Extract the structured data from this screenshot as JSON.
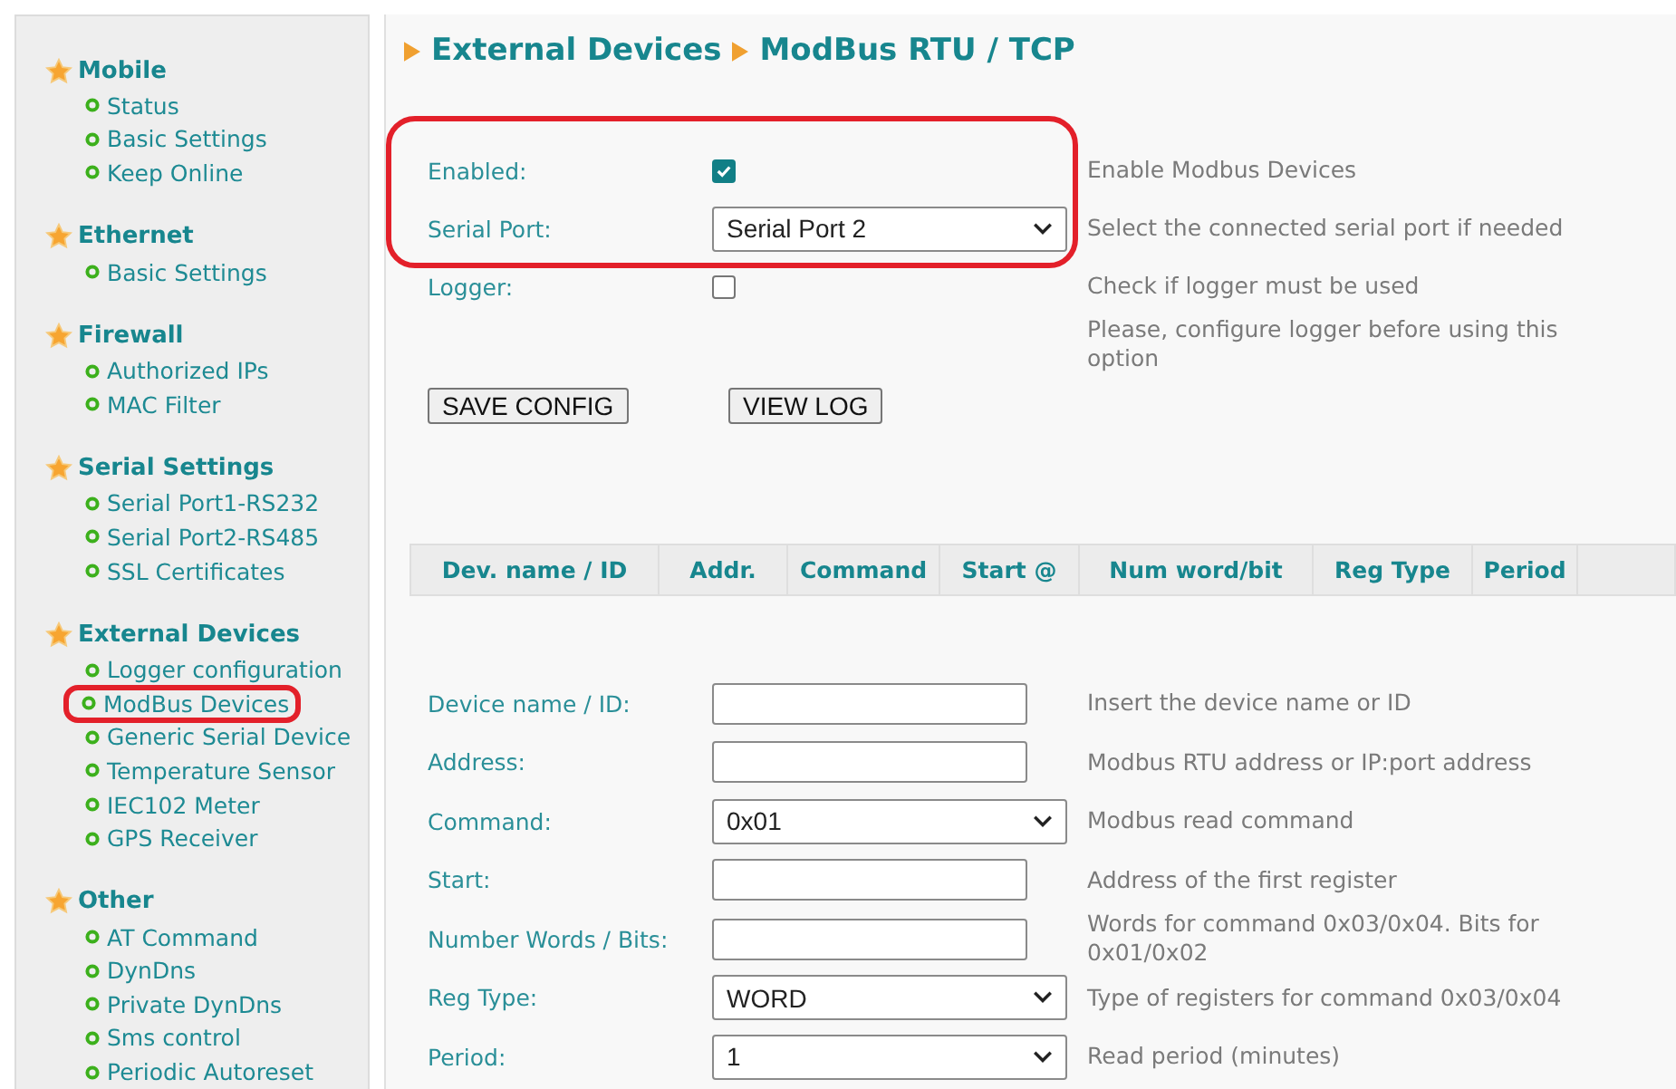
{
  "sidebar": {
    "sections": [
      {
        "title": "Mobile",
        "items": [
          {
            "label": "Status",
            "highlighted": false
          },
          {
            "label": "Basic Settings",
            "highlighted": false
          },
          {
            "label": "Keep Online",
            "highlighted": false
          }
        ]
      },
      {
        "title": "Ethernet",
        "items": [
          {
            "label": "Basic Settings",
            "highlighted": false
          }
        ]
      },
      {
        "title": "Firewall",
        "items": [
          {
            "label": "Authorized IPs",
            "highlighted": false
          },
          {
            "label": "MAC Filter",
            "highlighted": false
          }
        ]
      },
      {
        "title": "Serial Settings",
        "items": [
          {
            "label": "Serial Port1-RS232",
            "highlighted": false
          },
          {
            "label": "Serial Port2-RS485",
            "highlighted": false
          },
          {
            "label": "SSL Certificates",
            "highlighted": false
          }
        ]
      },
      {
        "title": "External Devices",
        "items": [
          {
            "label": "Logger configuration",
            "highlighted": false
          },
          {
            "label": "ModBus Devices",
            "highlighted": true
          },
          {
            "label": "Generic Serial Device",
            "highlighted": false
          },
          {
            "label": "Temperature Sensor",
            "highlighted": false
          },
          {
            "label": "IEC102 Meter",
            "highlighted": false
          },
          {
            "label": "GPS Receiver",
            "highlighted": false
          }
        ]
      },
      {
        "title": "Other",
        "items": [
          {
            "label": "AT Command",
            "highlighted": false
          },
          {
            "label": "DynDns",
            "highlighted": false
          },
          {
            "label": "Private DynDns",
            "highlighted": false
          },
          {
            "label": "Sms control",
            "highlighted": false
          },
          {
            "label": "Periodic Autoreset",
            "highlighted": false
          }
        ]
      }
    ]
  },
  "breadcrumb": [
    "External Devices",
    "ModBus RTU / TCP"
  ],
  "settings": [
    {
      "kind": "checkbox",
      "label": "Enabled:",
      "checked": true,
      "description": "Enable Modbus Devices",
      "highlighted": true
    },
    {
      "kind": "select",
      "label": "Serial Port:",
      "value": "Serial Port 2",
      "description": "Select the connected serial port if needed",
      "highlighted": true
    },
    {
      "kind": "checkbox",
      "label": "Logger:",
      "checked": false,
      "description": "Check if logger must be used",
      "highlighted": false
    },
    {
      "kind": "note",
      "description": "Please, configure logger before using this option",
      "highlighted": false
    }
  ],
  "buttons": [
    "SAVE CONFIG",
    "VIEW LOG"
  ],
  "table": {
    "columns": [
      "Dev. name / ID",
      "Addr.",
      "Command",
      "Start @",
      "Num word/bit",
      "Reg Type",
      "Period"
    ]
  },
  "device_form": [
    {
      "kind": "text",
      "label": "Device name / ID:",
      "description": "Insert the device name or ID"
    },
    {
      "kind": "text",
      "label": "Address:",
      "description": "Modbus RTU address or IP:port address"
    },
    {
      "kind": "select",
      "label": "Command:",
      "value": "0x01",
      "description": "Modbus read command"
    },
    {
      "kind": "text",
      "label": "Start:",
      "description": "Address of the first register"
    },
    {
      "kind": "text",
      "label": "Number Words / Bits:",
      "description": "Words for command 0x03/0x04. Bits for 0x01/0x02"
    },
    {
      "kind": "select",
      "label": "Reg Type:",
      "value": "WORD",
      "description": "Type of registers for command 0x03/0x04"
    },
    {
      "kind": "select",
      "label": "Period:",
      "value": "1",
      "description": "Read period (minutes)"
    }
  ]
}
